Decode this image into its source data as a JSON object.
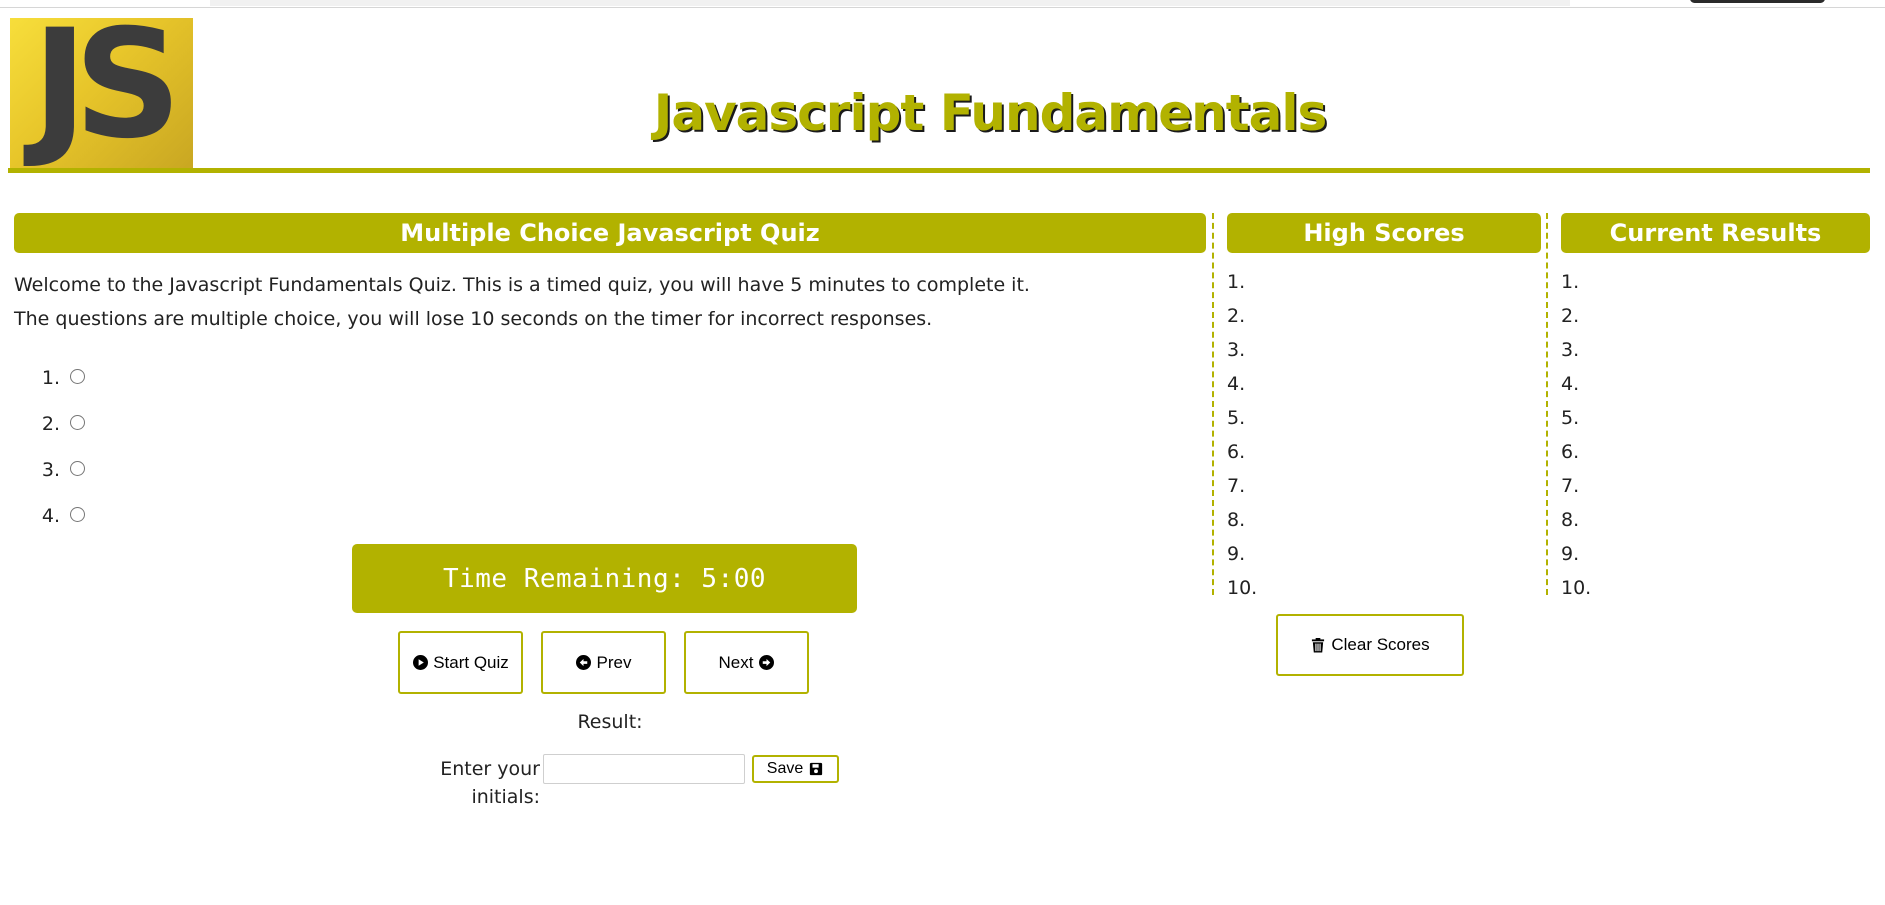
{
  "header": {
    "logo_text": "JS",
    "title": "Javascript Fundamentals"
  },
  "quiz": {
    "heading": "Multiple Choice Javascript Quiz",
    "intro": [
      "Welcome to the Javascript Fundamentals Quiz. This is a timed quiz, you will have 5 minutes to complete it.",
      "The questions are multiple choice, you will lose 10 seconds on the timer for incorrect responses."
    ],
    "choices": [
      {
        "number": "1.",
        "label": ""
      },
      {
        "number": "2.",
        "label": ""
      },
      {
        "number": "3.",
        "label": ""
      },
      {
        "number": "4.",
        "label": ""
      }
    ],
    "timer": "Time Remaining: 5:00",
    "buttons": {
      "start": "Start Quiz",
      "prev": "Prev",
      "next": "Next",
      "save": "Save"
    },
    "result_label": "Result:",
    "initials_label": "Enter your initials:",
    "initials_value": ""
  },
  "high_scores": {
    "heading": "High Scores",
    "items": [
      "1.",
      "2.",
      "3.",
      "4.",
      "5.",
      "6.",
      "7.",
      "8.",
      "9.",
      "10."
    ],
    "clear_label": "Clear Scores"
  },
  "current_results": {
    "heading": "Current Results",
    "items": [
      "1.",
      "2.",
      "3.",
      "4.",
      "5.",
      "6.",
      "7.",
      "8.",
      "9.",
      "10."
    ]
  },
  "icons": {
    "start": "play-circle-icon",
    "prev": "arrow-left-circle-icon",
    "next": "arrow-right-circle-icon",
    "clear": "trash-icon",
    "save": "floppy-disk-icon"
  },
  "colors": {
    "accent": "#b2b200",
    "logo_yellow": "#f0d532",
    "logo_text": "#3c3c3c",
    "title_shadow": "#1a1a1a"
  }
}
